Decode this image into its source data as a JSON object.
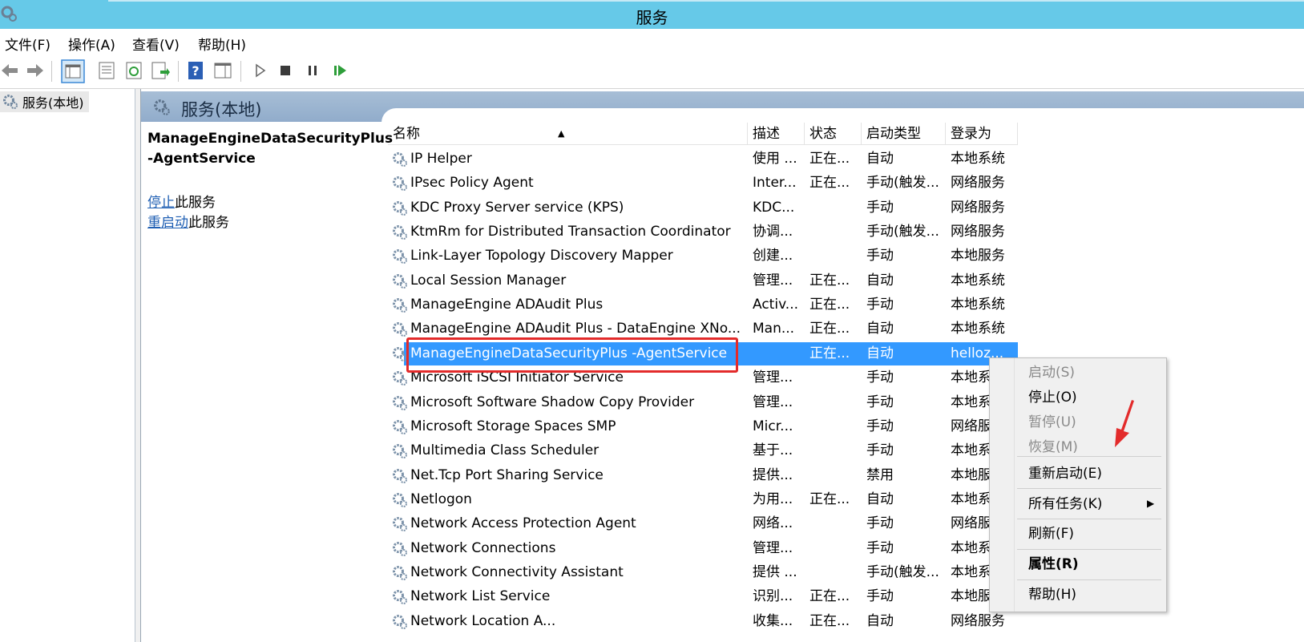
{
  "window": {
    "title": "服务"
  },
  "menu": [
    "文件(F)",
    "操作(A)",
    "查看(V)",
    "帮助(H)"
  ],
  "toolbar": [
    "back-icon",
    "forward-icon",
    "show-hide-console-tree-icon",
    "properties-icon",
    "refresh-icon",
    "export-list-icon",
    "help-icon",
    "action-pane-icon",
    "start-service-icon",
    "stop-service-icon",
    "pause-service-icon",
    "resume-service-icon"
  ],
  "tree": {
    "root_label": "服务(本地)"
  },
  "content": {
    "header": "服务(本地)",
    "selected_service": {
      "name_line1": "ManageEngineDataSecurityPlus",
      "name_line2": "-AgentService"
    },
    "actions": [
      {
        "link": "停止",
        "suffix": "此服务"
      },
      {
        "link": "重启动",
        "suffix": "此服务"
      }
    ]
  },
  "table": {
    "columns": [
      "名称",
      "描述",
      "状态",
      "启动类型",
      "登录为"
    ],
    "rows": [
      {
        "name": "IP Helper",
        "desc": "使用 ...",
        "status": "正在...",
        "startup": "自动",
        "logon": "本地系统"
      },
      {
        "name": "IPsec Policy Agent",
        "desc": "Inter...",
        "status": "正在...",
        "startup": "手动(触发...",
        "logon": "网络服务"
      },
      {
        "name": "KDC Proxy Server service (KPS)",
        "desc": "KDC...",
        "status": "",
        "startup": "手动",
        "logon": "网络服务"
      },
      {
        "name": "KtmRm for Distributed Transaction Coordinator",
        "desc": "协调...",
        "status": "",
        "startup": "手动(触发...",
        "logon": "网络服务"
      },
      {
        "name": "Link-Layer Topology Discovery Mapper",
        "desc": "创建...",
        "status": "",
        "startup": "手动",
        "logon": "本地服务"
      },
      {
        "name": "Local Session Manager",
        "desc": "管理...",
        "status": "正在...",
        "startup": "自动",
        "logon": "本地系统"
      },
      {
        "name": "ManageEngine ADAudit Plus",
        "desc": "Activ...",
        "status": "正在...",
        "startup": "手动",
        "logon": "本地系统"
      },
      {
        "name": "ManageEngine ADAudit Plus - DataEngine XNo...",
        "desc": "Man...",
        "status": "正在...",
        "startup": "自动",
        "logon": "本地系统"
      },
      {
        "name": "ManageEngineDataSecurityPlus -AgentService",
        "desc": "",
        "status": "正在...",
        "startup": "自动",
        "logon": "helloz...",
        "selected": true
      },
      {
        "name": "Microsoft iSCSI Initiator Service",
        "desc": "管理...",
        "status": "",
        "startup": "手动",
        "logon": "本地系"
      },
      {
        "name": "Microsoft Software Shadow Copy Provider",
        "desc": "管理...",
        "status": "",
        "startup": "手动",
        "logon": "本地系"
      },
      {
        "name": "Microsoft Storage Spaces SMP",
        "desc": "Micr...",
        "status": "",
        "startup": "手动",
        "logon": "网络服"
      },
      {
        "name": "Multimedia Class Scheduler",
        "desc": "基于...",
        "status": "",
        "startup": "手动",
        "logon": "本地系"
      },
      {
        "name": "Net.Tcp Port Sharing Service",
        "desc": "提供...",
        "status": "",
        "startup": "禁用",
        "logon": "本地服"
      },
      {
        "name": "Netlogon",
        "desc": "为用...",
        "status": "正在...",
        "startup": "自动",
        "logon": "本地系"
      },
      {
        "name": "Network Access Protection Agent",
        "desc": "网络...",
        "status": "",
        "startup": "手动",
        "logon": "网络服"
      },
      {
        "name": "Network Connections",
        "desc": "管理...",
        "status": "",
        "startup": "手动",
        "logon": "本地系"
      },
      {
        "name": "Network Connectivity Assistant",
        "desc": "提供 ...",
        "status": "",
        "startup": "手动(触发...",
        "logon": "本地系"
      },
      {
        "name": "Network List Service",
        "desc": "识别...",
        "status": "正在...",
        "startup": "手动",
        "logon": "本地服"
      },
      {
        "name": "Network Location A...",
        "desc": "收集...",
        "status": "正在...",
        "startup": "自动",
        "logon": "网络服务"
      }
    ]
  },
  "context_menu": {
    "items": [
      {
        "label": "启动(S)",
        "disabled": true
      },
      {
        "label": "停止(O)",
        "disabled": false
      },
      {
        "label": "暂停(U)",
        "disabled": true
      },
      {
        "label": "恢复(M)",
        "disabled": true
      },
      {
        "label": "重新启动(E)",
        "disabled": false
      },
      {
        "label": "所有任务(K)",
        "disabled": false,
        "submenu": true
      },
      {
        "label": "刷新(F)",
        "disabled": false
      },
      {
        "label": "属性(R)",
        "disabled": false,
        "bold": true
      },
      {
        "label": "帮助(H)",
        "disabled": false
      }
    ]
  },
  "annotations": {
    "highlight_color": "#e32b2b",
    "selection_color": "#3399ff"
  }
}
